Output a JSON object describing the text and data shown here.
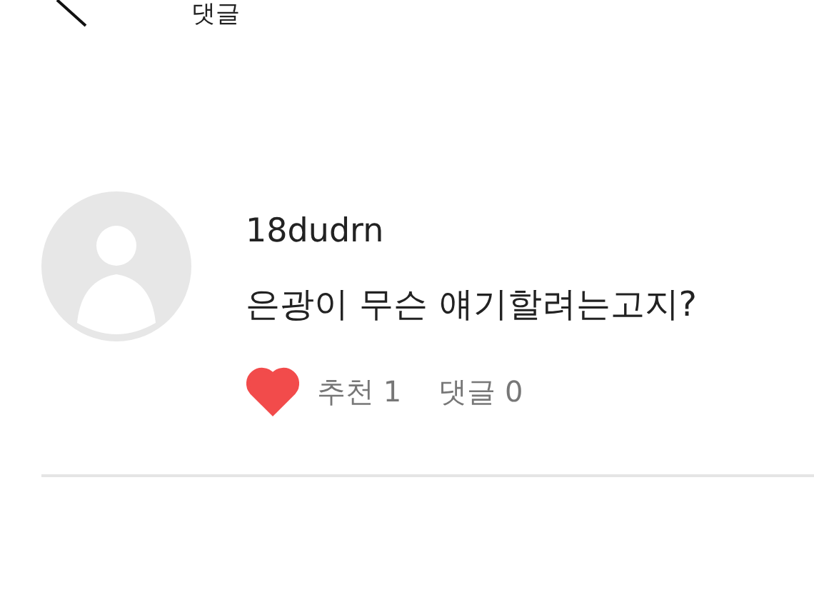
{
  "header": {
    "title": "댓글"
  },
  "comment": {
    "author": "18dudrn",
    "text": "은광이 무슨 얘기할려는고지?",
    "liked": true,
    "likes": "추천 1",
    "replies": "댓글 0"
  }
}
